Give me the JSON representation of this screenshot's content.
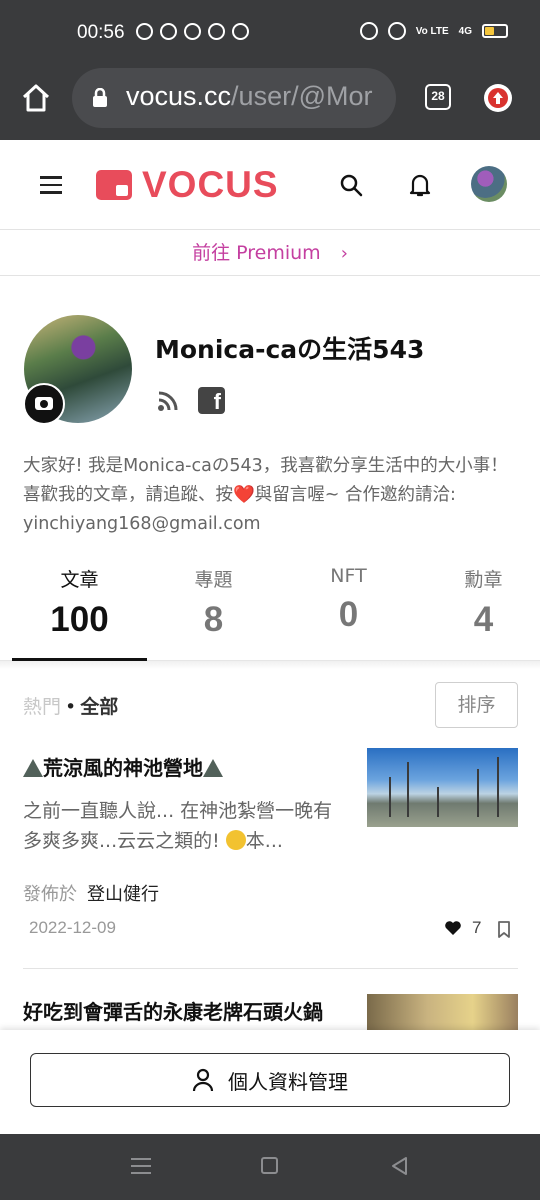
{
  "status_bar": {
    "time": "00:56",
    "network_label": "4G",
    "volte_label": "Vo LTE"
  },
  "browser": {
    "url_host": "vocus.cc",
    "url_path": "/user/@Mor",
    "tab_count": "28"
  },
  "header": {
    "logo_text": "VOCUS"
  },
  "premium": {
    "label": "前往 Premium",
    "chevron": "›"
  },
  "profile": {
    "name": "Monica-caの生活543",
    "bio_part1": "大家好! 我是Monica-caの543，我喜歡分享生活中的大小事！喜歡我的文章，請追蹤、按",
    "bio_part2": "與留言喔~ 合作邀約請洽: yinchiyang168@gmail.com",
    "heart_emoji": "❤️"
  },
  "stats": [
    {
      "label": "文章",
      "value": "100"
    },
    {
      "label": "專題",
      "value": "8"
    },
    {
      "label": "NFT",
      "value": "0"
    },
    {
      "label": "勳章",
      "value": "4"
    }
  ],
  "filter": {
    "hot": "熱門",
    "separator": "•",
    "all": "全部",
    "sort": "排序"
  },
  "articles": [
    {
      "title": "荒涼風的神池營地",
      "excerpt": "之前一直聽人說... 在神池紮營一晚有多爽多爽...云云之類的! ",
      "excerpt_tail": "本...",
      "published_prefix": "發佈於",
      "category": "登山健行",
      "date": "2022-12-09",
      "likes": "7"
    },
    {
      "title": "好吃到會彈舌的永康老牌石頭火鍋"
    }
  ],
  "bottom": {
    "manage_label": "個人資料管理"
  },
  "colors": {
    "brand": "#e84c5b",
    "premium": "#c43fa0",
    "chrome": "#3a3b3d"
  }
}
